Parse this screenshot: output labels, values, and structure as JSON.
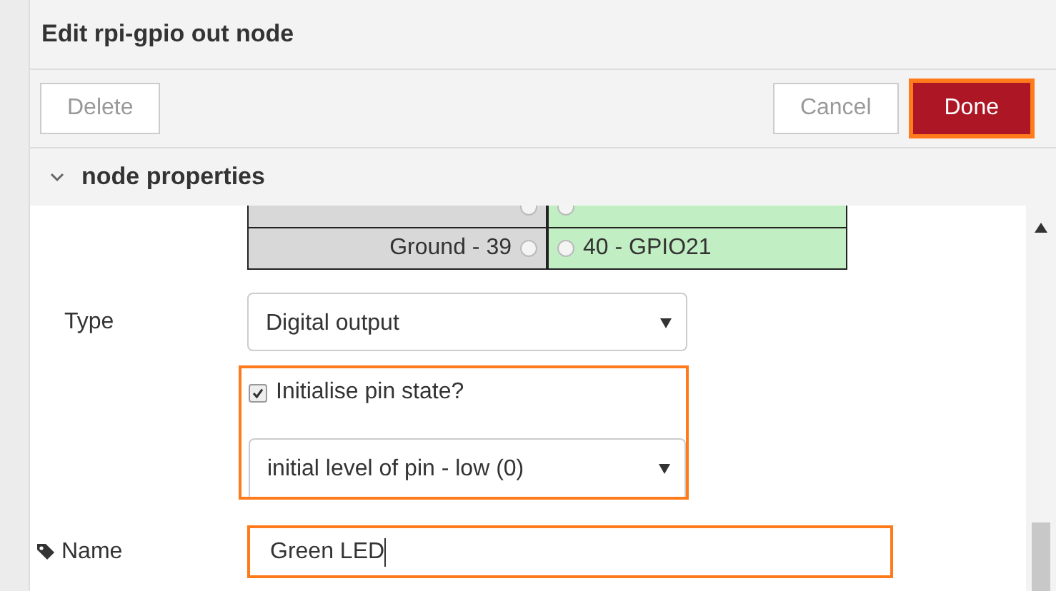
{
  "dialog": {
    "title": "Edit rpi-gpio out node"
  },
  "toolbar": {
    "buttons": [
      {
        "label": "Delete",
        "kind": "secondary",
        "highlighted": false
      },
      {
        "label": "Cancel",
        "kind": "secondary",
        "highlighted": false
      },
      {
        "label": "Done",
        "kind": "primary",
        "highlighted": true
      }
    ]
  },
  "section": {
    "title": "node properties",
    "expanded": true
  },
  "pin_table": {
    "rows": [
      {
        "left": {
          "power": true
        },
        "right": {
          "power": false
        }
      },
      {
        "left": {
          "label": "Ground - 39",
          "power": true
        },
        "right": {
          "label": "40 - GPIO21",
          "power": false
        }
      }
    ]
  },
  "type": {
    "label": "Type",
    "value": "Digital output"
  },
  "init": {
    "label": "Initialise pin state?",
    "checked": true,
    "highlighted": true,
    "level_value": "initial level of pin - low (0)"
  },
  "name": {
    "label": "Name",
    "value": "Green LED",
    "highlighted": true
  }
}
